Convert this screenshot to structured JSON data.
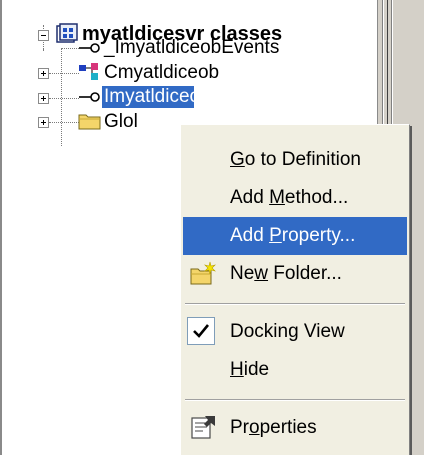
{
  "tree": {
    "root": {
      "label": "myatldicesvr classes",
      "expanded": true
    },
    "children": [
      {
        "label": "_ImyatldiceobEvents",
        "kind": "interface",
        "icon": "interface-icon"
      },
      {
        "label": "Cmyatldiceob",
        "kind": "class",
        "icon": "class-icon"
      },
      {
        "label": "Imyatldiceob",
        "kind": "interface",
        "icon": "interface-icon",
        "selected": true
      },
      {
        "label": "Glol",
        "kind": "folder",
        "icon": "folder-icon"
      }
    ]
  },
  "context_menu": {
    "items": [
      {
        "pre": "",
        "u": "G",
        "post": "o to Definition"
      },
      {
        "pre": "Add ",
        "u": "M",
        "post": "ethod..."
      },
      {
        "pre": "Add ",
        "u": "P",
        "post": "roperty...",
        "highlighted": true
      },
      {
        "pre": "Ne",
        "u": "w",
        "post": " Folder..."
      },
      {
        "pre": "Docking View",
        "u": "",
        "post": "",
        "checked": true
      },
      {
        "pre": "",
        "u": "H",
        "post": "ide"
      },
      {
        "pre": "Pr",
        "u": "o",
        "post": "perties"
      }
    ]
  },
  "colors": {
    "selection": "#316ac5",
    "menu_bg": "#f1efe2",
    "splitter_bg": "#d4d0c8"
  }
}
